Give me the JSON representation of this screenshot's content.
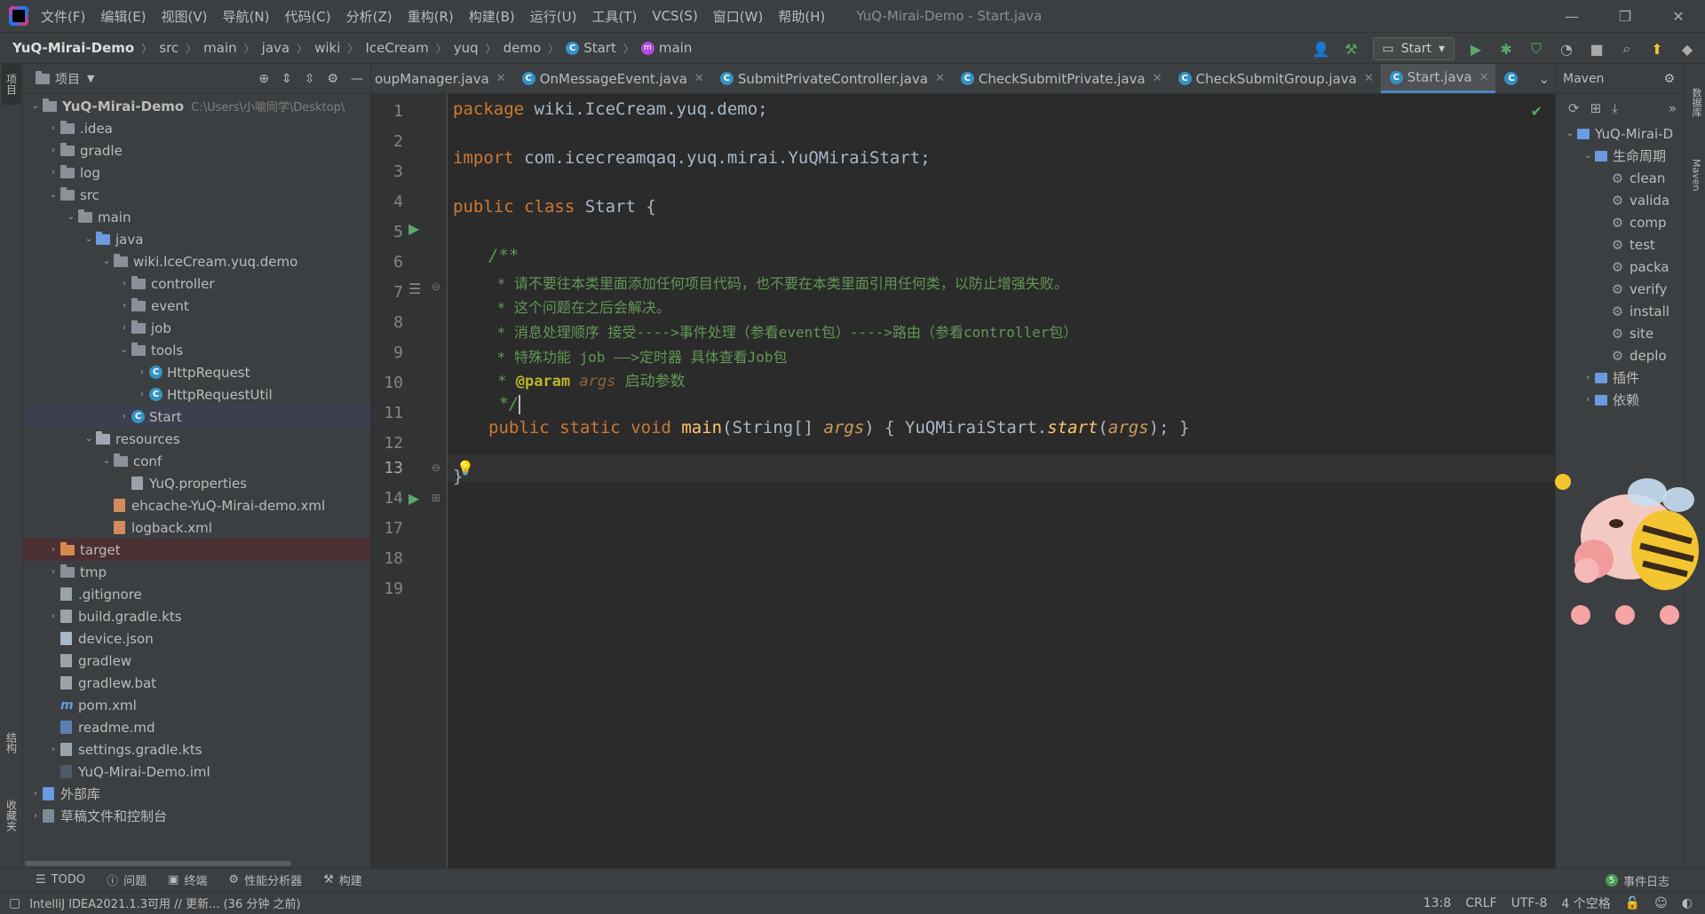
{
  "menu": [
    "文件(F)",
    "编辑(E)",
    "视图(V)",
    "导航(N)",
    "代码(C)",
    "分析(Z)",
    "重构(R)",
    "构建(B)",
    "运行(U)",
    "工具(T)",
    "VCS(S)",
    "窗口(W)",
    "帮助(H)"
  ],
  "window_title": "YuQ-Mirai-Demo - Start.java",
  "breadcrumbs": [
    "YuQ-Mirai-Demo",
    "src",
    "main",
    "java",
    "wiki",
    "IceCream",
    "yuq",
    "demo",
    "Start",
    "main"
  ],
  "run_config": "Start",
  "left_strip": {
    "project_tab": "项目",
    "structure_tab": "结构",
    "favorites_tab": "收藏夹"
  },
  "project": {
    "title": "项目",
    "tree": [
      {
        "label": "YuQ-Mirai-Demo",
        "hint": "C:\\Users\\小喻同学\\Desktop\\"
      },
      {
        "label": ".idea"
      },
      {
        "label": "gradle"
      },
      {
        "label": "log"
      },
      {
        "label": "src"
      },
      {
        "label": "main"
      },
      {
        "label": "java"
      },
      {
        "label": "wiki.IceCream.yuq.demo"
      },
      {
        "label": "controller"
      },
      {
        "label": "event"
      },
      {
        "label": "job"
      },
      {
        "label": "tools"
      },
      {
        "label": "HttpRequest"
      },
      {
        "label": "HttpRequestUtil"
      },
      {
        "label": "Start"
      },
      {
        "label": "resources"
      },
      {
        "label": "conf"
      },
      {
        "label": "YuQ.properties"
      },
      {
        "label": "ehcache-YuQ-Mirai-demo.xml"
      },
      {
        "label": "logback.xml"
      },
      {
        "label": "target"
      },
      {
        "label": "tmp"
      },
      {
        "label": ".gitignore"
      },
      {
        "label": "build.gradle.kts"
      },
      {
        "label": "device.json"
      },
      {
        "label": "gradlew"
      },
      {
        "label": "gradlew.bat"
      },
      {
        "label": "pom.xml"
      },
      {
        "label": "readme.md"
      },
      {
        "label": "settings.gradle.kts"
      },
      {
        "label": "YuQ-Mirai-Demo.iml"
      },
      {
        "label": "外部库"
      },
      {
        "label": "草稿文件和控制台"
      }
    ]
  },
  "tabs": [
    "oupManager.java",
    "OnMessageEvent.java",
    "SubmitPrivateController.java",
    "CheckSubmitPrivate.java",
    "CheckSubmitGroup.java",
    "Start.java"
  ],
  "editor": {
    "line_numbers": [
      "1",
      "2",
      "3",
      "4",
      "5",
      "6",
      "7",
      "8",
      "9",
      "10",
      "11",
      "12",
      "13",
      "14",
      "17",
      "18",
      "19"
    ],
    "current_line": "13",
    "code": {
      "l1_kw": "package",
      "l1_rest": " wiki.IceCream.yuq.demo;",
      "l3_kw": "import",
      "l3_rest": " com.icecreamqaq.yuq.mirai.YuQMiraiStart;",
      "l5_kw": "public class",
      "l5_rest": " Start {",
      "l7": "/**",
      "l8": " * 请不要往本类里面添加任何项目代码，也不要在本类里面引用任何类，以防止增强失败。",
      "l9": " * 这个问题在之后会解决。",
      "l10": " * 消息处理顺序 接受---->事件处理（参看event包）---->路由（参看controller包）",
      "l11": " * 特殊功能 job ——>定时器 具体查看Job包",
      "l12_pre": " * ",
      "l12_tag": "@param",
      "l12_param": "args",
      "l12_desc": " 启动参数",
      "l13": " */",
      "l14_kw": "public static void",
      "l14_fn": "main",
      "l14_a": "(String[] ",
      "l14_param": "args",
      "l14_b": ") { ",
      "l14_cls": "YuQMiraiStart",
      "l14_dot": ".",
      "l14_call": "start",
      "l14_c": "(",
      "l14_param2": "args",
      "l14_d": "); }",
      "l18": "}"
    }
  },
  "maven": {
    "title": "Maven",
    "project": "YuQ-Mirai-D",
    "lifecycle": "生命周期",
    "goals": [
      "clean",
      "valida",
      "comp",
      "test",
      "packa",
      "verify",
      "install",
      "site",
      "deplo"
    ],
    "plugins": "插件",
    "deps": "依赖"
  },
  "right_strip": {
    "db_tab": "数据库",
    "maven_tab": "Maven"
  },
  "bottom_tools": [
    "TODO",
    "问题",
    "终端",
    "性能分析器",
    "构建"
  ],
  "event_log": {
    "count": "5",
    "label": "事件日志"
  },
  "status": {
    "message": "IntelliJ IDEA2021.1.3可用 // 更新... (36 分钟 之前)",
    "position": "13:8",
    "line_sep": "CRLF",
    "encoding": "UTF-8",
    "indent": "4 个空格"
  },
  "colors": {
    "accent": "#4a88c7",
    "run_green": "#59a869",
    "bg": "#2b2b2b",
    "panel": "#3c3f41"
  }
}
